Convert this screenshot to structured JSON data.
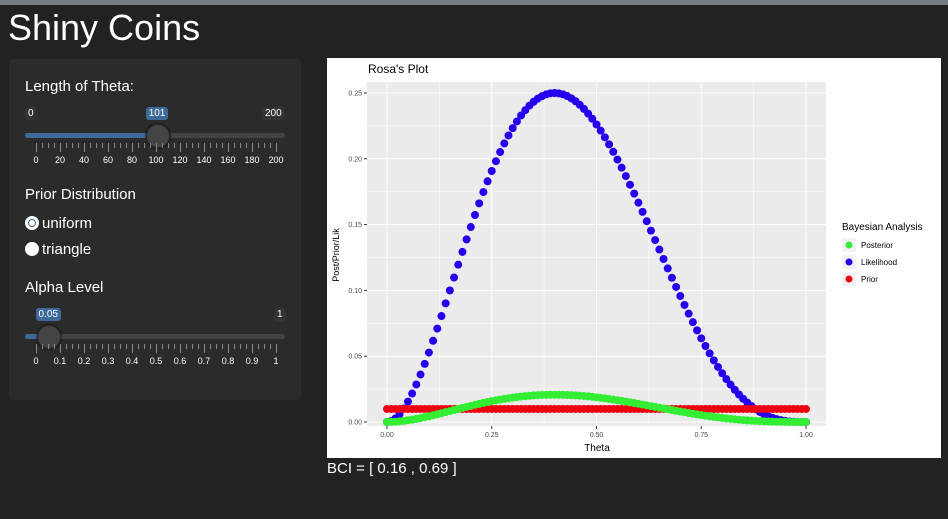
{
  "app_title": "Shiny Coins",
  "sidebar": {
    "theta_length": {
      "label": "Length of Theta:",
      "min": "0",
      "max": "200",
      "value": "101",
      "value_fraction": 0.505,
      "tick_labels": [
        "0",
        "20",
        "40",
        "60",
        "80",
        "100",
        "120",
        "140",
        "160",
        "180",
        "200"
      ]
    },
    "prior": {
      "label": "Prior Distribution",
      "options": [
        {
          "label": "uniform",
          "checked": true
        },
        {
          "label": "triangle",
          "checked": false
        }
      ]
    },
    "alpha": {
      "label": "Alpha Level",
      "min": "0",
      "max": "1",
      "value": "0.05",
      "value_fraction": 0.05,
      "tick_labels": [
        "0",
        "0.1",
        "0.2",
        "0.3",
        "0.4",
        "0.5",
        "0.6",
        "0.7",
        "0.8",
        "0.9",
        "1"
      ]
    }
  },
  "plot": {
    "colors": {
      "panel_bg": "#ebebeb",
      "grid": "#ffffff",
      "posterior": "#33ee33",
      "likelihood": "#2200ee",
      "prior": "#ee0011"
    },
    "chart_data": {
      "type": "scatter",
      "title": "Rosa's Plot",
      "xlabel": "Theta",
      "ylabel": "Post/Prior/Lik",
      "xlim": [
        0,
        1
      ],
      "ylim": [
        0,
        0.25
      ],
      "x_tick_labels": [
        "0.00",
        "0.25",
        "0.50",
        "0.75",
        "1.00"
      ],
      "y_tick_labels": [
        "0.00",
        "0.05",
        "0.10",
        "0.15",
        "0.20",
        "0.25"
      ],
      "x_ticks": [
        0,
        0.25,
        0.5,
        0.75,
        1
      ],
      "y_ticks": [
        0,
        0.05,
        0.1,
        0.15,
        0.2,
        0.25
      ],
      "n_points": 101,
      "grid": true,
      "legend": {
        "title": "Bayesian Analysis",
        "position": "right",
        "entries": [
          "Posterior",
          "Likelihood",
          "Prior"
        ]
      },
      "series": [
        {
          "name": "Posterior",
          "color": "#33ee33",
          "description": "peak 0.0255 at theta 0.4"
        },
        {
          "name": "Likelihood",
          "color": "#2200ee",
          "description": "peak 0.251 at theta 0.4"
        },
        {
          "name": "Prior",
          "color": "#ee0011",
          "description": "constant 0.0099"
        }
      ]
    }
  },
  "bci_text": "BCI = [ 0.16 , 0.69 ]"
}
